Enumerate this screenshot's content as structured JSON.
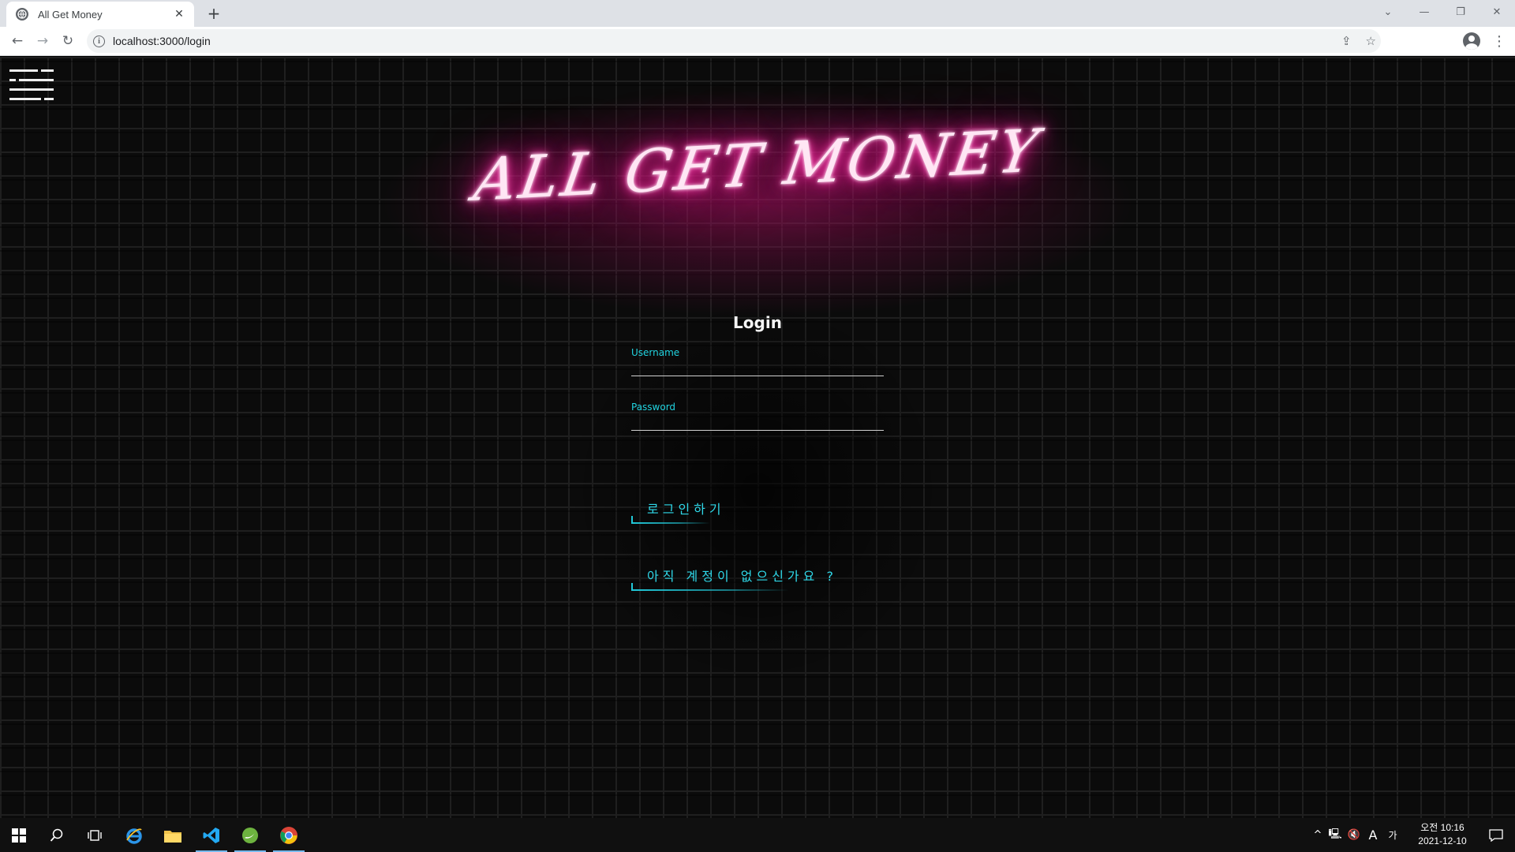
{
  "browser": {
    "tab_title": "All Get Money",
    "tab_close": "✕",
    "new_tab": "+",
    "url": "localhost:3000/login"
  },
  "page": {
    "neon_title": "ALL GET MONEY",
    "login_heading": "Login",
    "username_label": "Username",
    "password_label": "Password",
    "login_button": "로그인하기",
    "signup_link": "아직 계정이 없으신가요 ?"
  },
  "taskbar": {
    "clock_time": "오전 10:16",
    "clock_date": "2021-12-10",
    "ime_label": "A",
    "ime_mode": "가"
  },
  "colors": {
    "neon_pink": "#ff2aa5",
    "neon_cyan": "#2fd9ea",
    "background": "#0b0b0b"
  }
}
